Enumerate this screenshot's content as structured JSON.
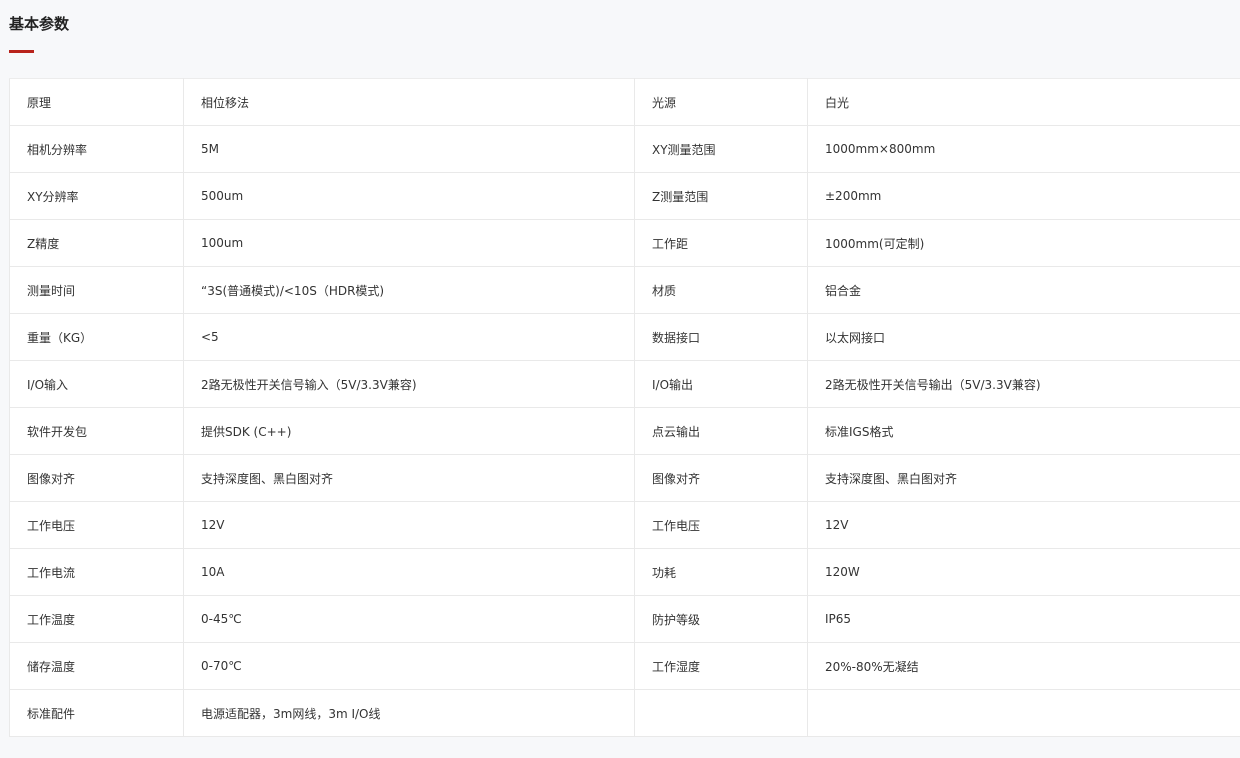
{
  "section": {
    "title": "基本参数",
    "accent_color": "#b8221b"
  },
  "specs": {
    "rows": [
      {
        "left_label": "原理",
        "left_value": "相位移法",
        "right_label": "光源",
        "right_value": "白光"
      },
      {
        "left_label": "相机分辨率",
        "left_value": "5M",
        "right_label": "XY测量范围",
        "right_value": "1000mm×800mm"
      },
      {
        "left_label": "XY分辨率",
        "left_value": "500um",
        "right_label": "Z测量范围",
        "right_value": "±200mm"
      },
      {
        "left_label": "Z精度",
        "left_value": "100um",
        "right_label": "工作距",
        "right_value": "1000mm(可定制)"
      },
      {
        "left_label": "测量时间",
        "left_value": "“3S(普通模式)/<10S（HDR模式)",
        "right_label": "材质",
        "right_value": "铝合金"
      },
      {
        "left_label": "重量（KG）",
        "left_value": "<5",
        "right_label": "数据接口",
        "right_value": "以太网接口"
      },
      {
        "left_label": "I/O输入",
        "left_value": "2路无极性开关信号输入（5V/3.3V兼容)",
        "right_label": "I/O输出",
        "right_value": "2路无极性开关信号输出（5V/3.3V兼容)"
      },
      {
        "left_label": "软件开发包",
        "left_value": "提供SDK (C++)",
        "right_label": "点云输出",
        "right_value": "标准IGS格式"
      },
      {
        "left_label": "图像对齐",
        "left_value": "支持深度图、黑白图对齐",
        "right_label": "图像对齐",
        "right_value": "支持深度图、黑白图对齐"
      },
      {
        "left_label": "工作电压",
        "left_value": "12V",
        "right_label": "工作电压",
        "right_value": "12V"
      },
      {
        "left_label": "工作电流",
        "left_value": "10A",
        "right_label": "功耗",
        "right_value": "120W"
      },
      {
        "left_label": "工作温度",
        "left_value": "0-45℃",
        "right_label": "防护等级",
        "right_value": "IP65"
      },
      {
        "left_label": "储存温度",
        "left_value": "0-70℃",
        "right_label": "工作湿度",
        "right_value": "20%-80%无凝结"
      },
      {
        "left_label": "标准配件",
        "left_value": "电源适配器，3m网线，3m I/O线",
        "right_label": "",
        "right_value": ""
      }
    ]
  }
}
